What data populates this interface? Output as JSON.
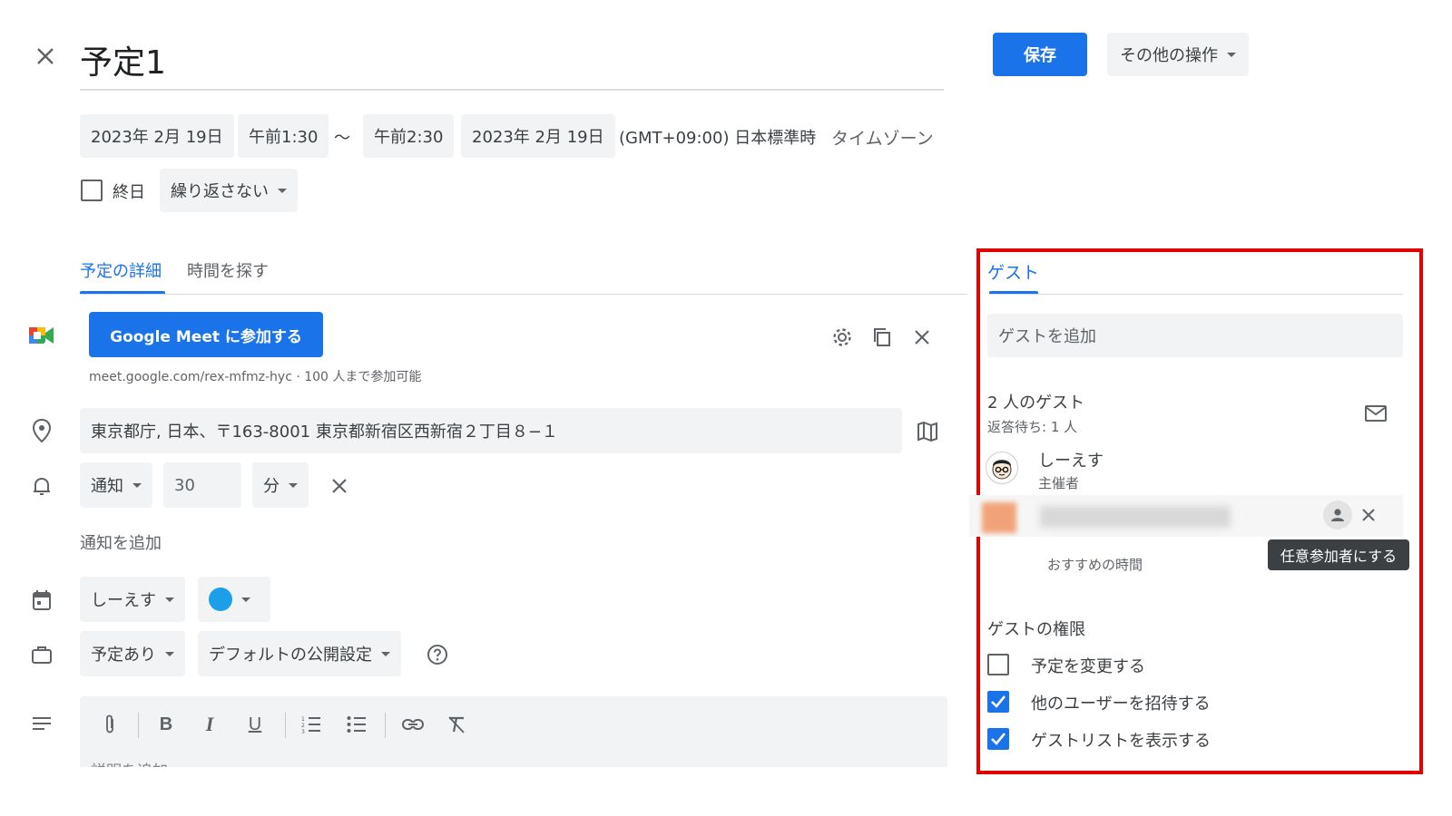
{
  "header": {
    "title": "予定1",
    "save_label": "保存",
    "more_actions_label": "その他の操作"
  },
  "datetime": {
    "start_date": "2023年 2月 19日",
    "start_time": "午前1:30",
    "separator": "〜",
    "end_time": "午前2:30",
    "end_date": "2023年 2月 19日",
    "timezone_value": "(GMT+09:00) 日本標準時",
    "timezone_link": "タイムゾーン",
    "allday_label": "終日",
    "repeat_label": "繰り返さない"
  },
  "tabs": {
    "details": "予定の詳細",
    "find_time": "時間を探す"
  },
  "meet": {
    "join_label": "Google Meet に参加する",
    "link_info": "meet.google.com/rex-mfmz-hyc · 100 人まで参加可能"
  },
  "location": {
    "value": "東京都庁, 日本、〒163-8001 東京都新宿区西新宿２丁目８−１"
  },
  "notification": {
    "type": "通知",
    "amount": "30",
    "unit": "分",
    "add_label": "通知を追加"
  },
  "calendar": {
    "owner": "しーえす",
    "color": "#1a9fe8"
  },
  "visibility": {
    "busy": "予定あり",
    "privacy": "デフォルトの公開設定"
  },
  "description": {
    "placeholder": "説明を追加"
  },
  "guests": {
    "tab_label": "ゲスト",
    "add_placeholder": "ゲストを追加",
    "count_label": "2 人のゲスト",
    "pending_label": "返答待ち: 1 人",
    "organizer_name": "しーえす",
    "organizer_role": "主催者",
    "tooltip": "任意参加者にする",
    "suggested_times": "おすすめの時間",
    "permissions_title": "ゲストの権限",
    "perm_modify": "予定を変更する",
    "perm_invite": "他のユーザーを招待する",
    "perm_see_list": "ゲストリストを表示する"
  },
  "colors": {
    "accent": "#1a73e8",
    "highlight_border": "#e00000"
  }
}
